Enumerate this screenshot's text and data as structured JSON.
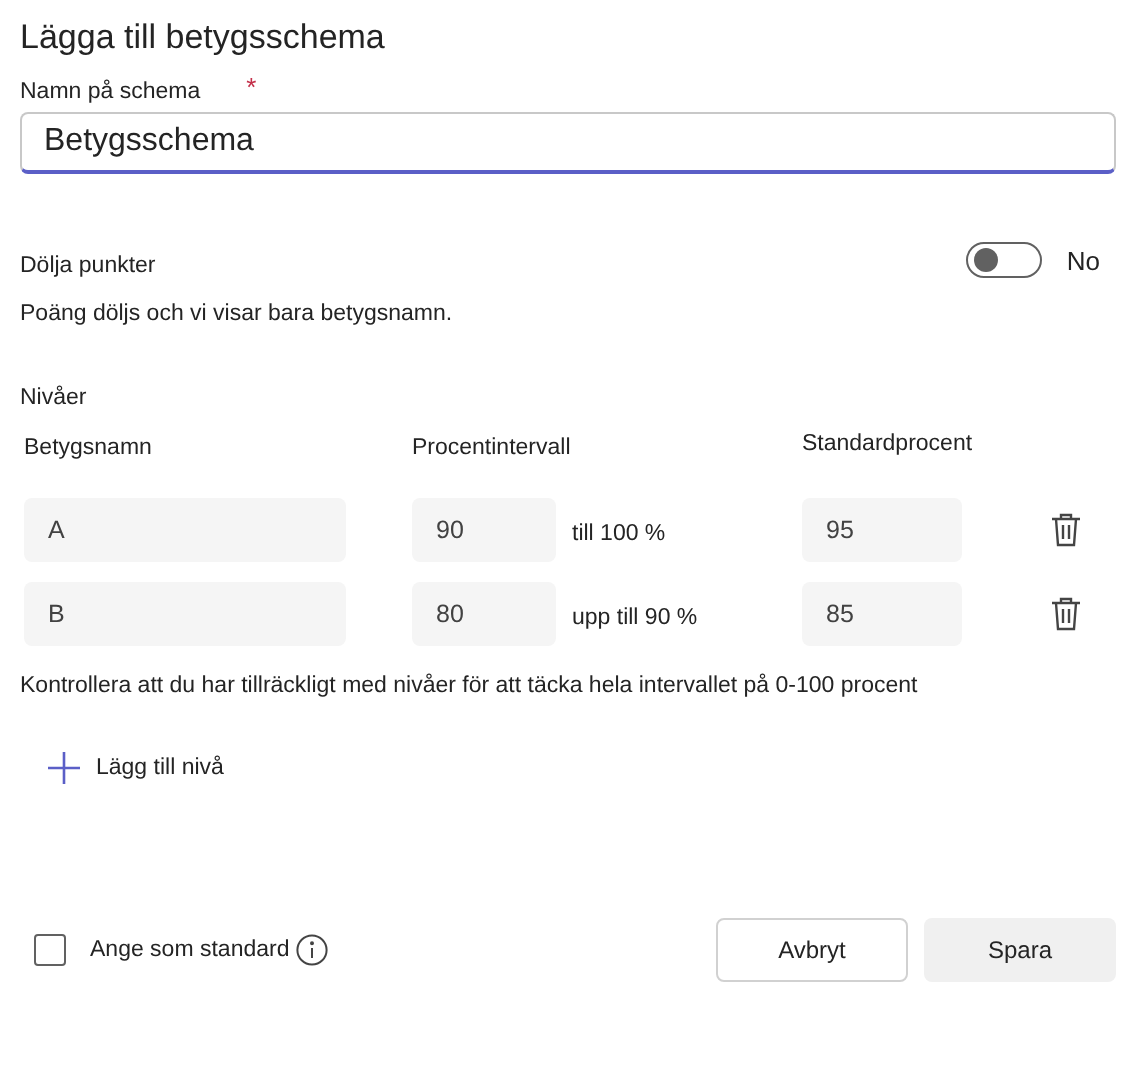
{
  "title": "Lägga till betygsschema",
  "name_field": {
    "label": "Namn på schema",
    "required_mark": "*",
    "value": "Betygsschema"
  },
  "hide_points": {
    "label": "Dölja punkter",
    "on": false,
    "state_text": "No",
    "help": "Poäng döljs och vi visar bara betygsnamn."
  },
  "levels": {
    "heading": "Nivåer",
    "columns": [
      "Betygsnamn",
      "Procentintervall",
      "Standardprocent"
    ],
    "rows": [
      {
        "name": "A",
        "from": "90",
        "range_text": "till 100 %",
        "default": "95"
      },
      {
        "name": "B",
        "from": "80",
        "range_text": "upp till 90 %",
        "default": "85"
      }
    ],
    "warning": "Kontrollera att du har tillräckligt med nivåer för att täcka hela intervallet på 0-100 procent",
    "add_label": "Lägg till nivå"
  },
  "set_default": {
    "label": "Ange som standard",
    "checked": false
  },
  "buttons": [
    {
      "label": "Avbryt",
      "kind": "secondary"
    },
    {
      "label": "Spara",
      "kind": "primary"
    }
  ]
}
